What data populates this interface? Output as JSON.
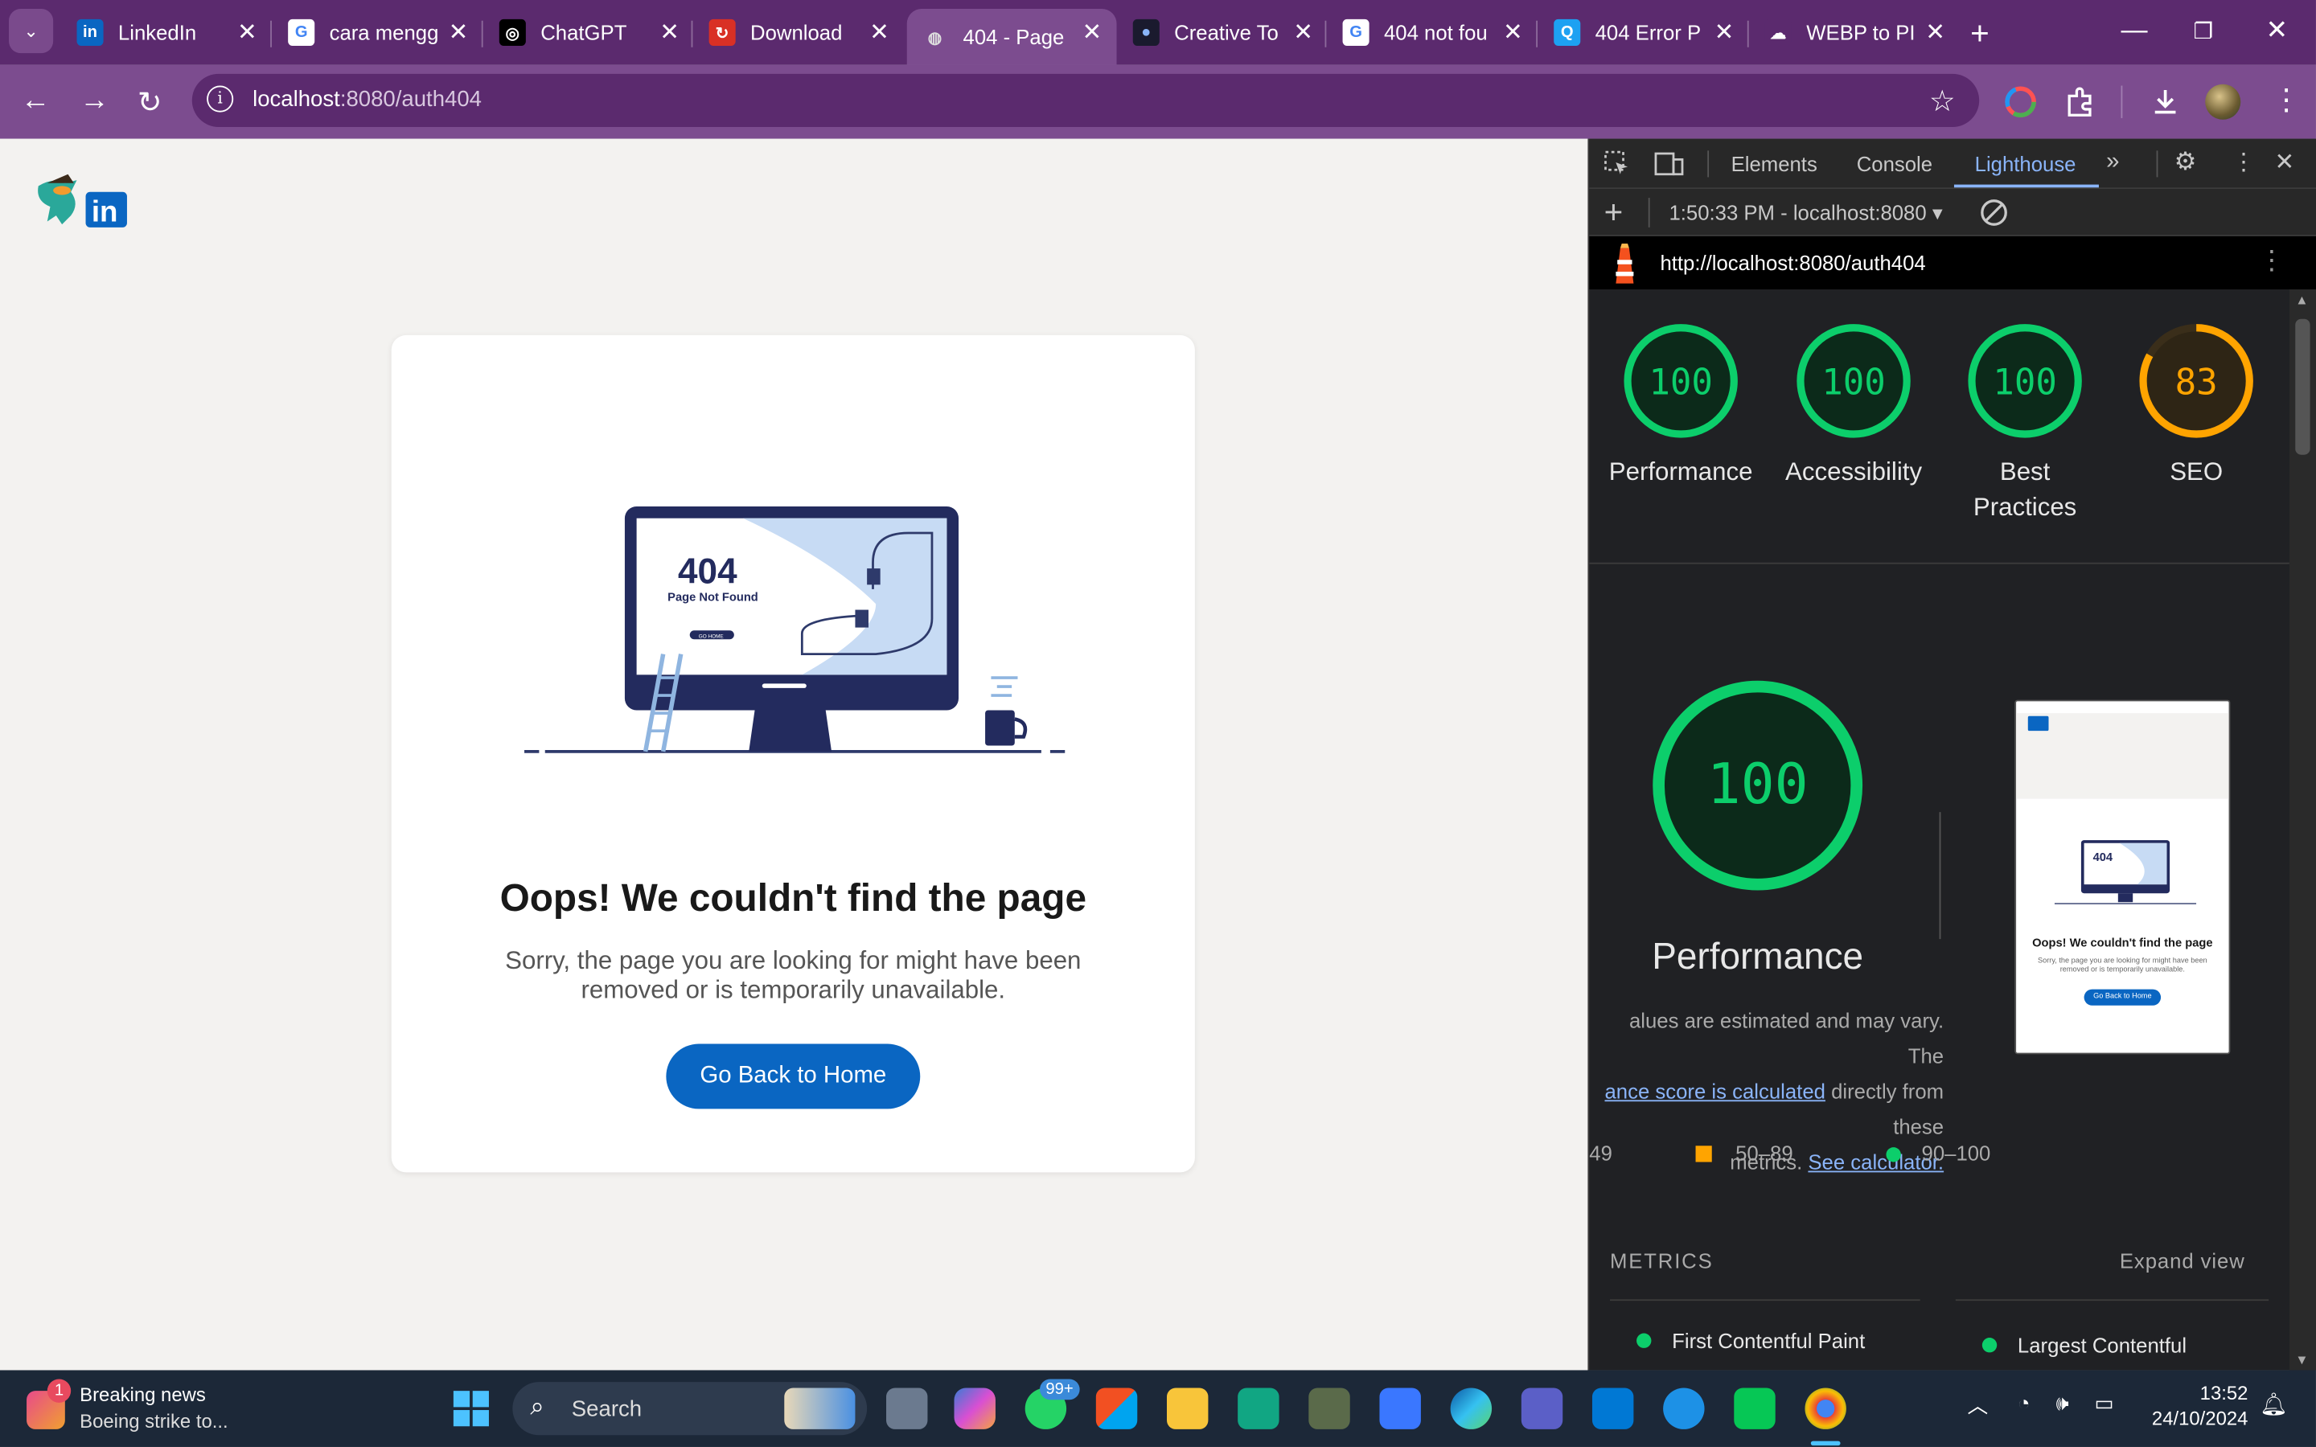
{
  "browser": {
    "tabs": [
      {
        "title": "LinkedIn",
        "fav": "in",
        "favbg": "#0a66c2",
        "favfg": "#fff"
      },
      {
        "title": "cara mengg",
        "fav": "G",
        "favbg": "#ffffff",
        "favfg": "#4285f4"
      },
      {
        "title": "ChatGPT",
        "fav": "◎",
        "favbg": "#000000",
        "favfg": "#fff"
      },
      {
        "title": "Download",
        "fav": "↻",
        "favbg": "#d93025",
        "favfg": "#fff"
      },
      {
        "title": "404 - Page",
        "fav": "◍",
        "favbg": "#7c4c8f",
        "favfg": "#ddd"
      },
      {
        "title": "Creative To",
        "fav": "●",
        "favbg": "#1a1a2e",
        "favfg": "#8ab4f8"
      },
      {
        "title": "404 not fou",
        "fav": "G",
        "favbg": "#ffffff",
        "favfg": "#4285f4"
      },
      {
        "title": "404 Error P",
        "fav": "Q",
        "favbg": "#1da1f2",
        "favfg": "#fff"
      },
      {
        "title": "WEBP to PI",
        "fav": "☁",
        "favbg": "#5b2a6e",
        "favfg": "#fff"
      }
    ],
    "url_host": "localhost",
    "url_path": ":8080/auth404"
  },
  "page": {
    "illus_404": "404",
    "illus_notfound": "Page Not Found",
    "illus_gohome": "GO HOME",
    "heading": "Oops! We couldn't find the page",
    "message": "Sorry, the page you are looking for might have been removed or is temporarily unavailable.",
    "button": "Go Back to Home"
  },
  "devtools": {
    "tabs": [
      "Elements",
      "Console",
      "Lighthouse"
    ],
    "report_time": "1:50:33 PM - localhost:8080",
    "report_url": "http://localhost:8080/auth404",
    "scores": [
      {
        "label": "Performance",
        "value": 100,
        "color": "#0cce6b"
      },
      {
        "label": "Accessibility",
        "value": 100,
        "color": "#0cce6b"
      },
      {
        "label": "Best Practices",
        "value": 100,
        "color": "#0cce6b"
      },
      {
        "label": "SEO",
        "value": 83,
        "color": "#ffa400"
      }
    ],
    "perf_score": "100",
    "perf_title": "Performance",
    "perf_desc_1": "alues are estimated and may vary. The",
    "perf_desc_link": "ance score is calculated",
    "perf_desc_2": " directly from these",
    "perf_desc_3": "metrics.",
    "perf_desc_link2": "See calculator.",
    "legend": [
      "49",
      "50–89",
      "90–100"
    ],
    "metrics_header": "METRICS",
    "expand": "Expand view",
    "metric_1": "First Contentful Paint",
    "metric_2": "Largest Contentful"
  },
  "thumb": {
    "heading": "Oops! We couldn't find the page",
    "message": "Sorry, the page you are looking for might have been removed or is temporarily unavailable.",
    "button": "Go Back to Home"
  },
  "taskbar": {
    "news_title": "Breaking news",
    "news_sub": "Boeing strike to...",
    "news_badge": "1",
    "search": "Search",
    "whatsapp_badge": "99+",
    "time": "13:52",
    "date": "24/10/2024"
  }
}
